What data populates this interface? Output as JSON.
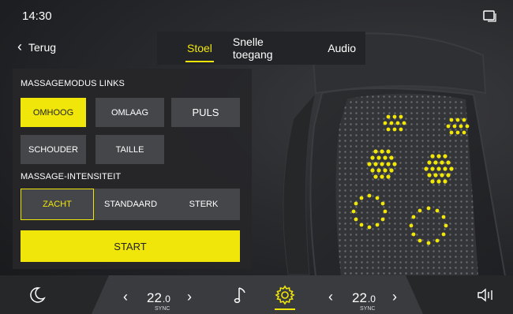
{
  "status": {
    "time": "14:30"
  },
  "nav": {
    "back_label": "Terug"
  },
  "tabs": [
    {
      "label": "Stoel",
      "active": true
    },
    {
      "label": "Snelle toegang",
      "active": false
    },
    {
      "label": "Audio",
      "active": false
    }
  ],
  "massage_mode": {
    "title": "MASSAGEMODUS LINKS",
    "options": [
      "OMHOOG",
      "OMLAAG",
      "PULS",
      "SCHOUDER",
      "TAILLE"
    ],
    "selected": "OMHOOG"
  },
  "intensity": {
    "title": "MASSAGE-INTENSITEIT",
    "options": [
      "ZACHT",
      "STANDAARD",
      "STERK"
    ],
    "selected": "ZACHT"
  },
  "start_label": "START",
  "climate": {
    "left": {
      "temp": "22",
      "decimal": ".0",
      "sync": "SYNC"
    },
    "right": {
      "temp": "22",
      "decimal": ".0",
      "sync": "SYNC"
    }
  },
  "colors": {
    "accent": "#f0e60a",
    "panel": "#26272a",
    "button": "#45464a"
  },
  "icons": [
    "phone-mirror-icon",
    "back-chevron-icon",
    "moon-icon",
    "music-note-icon",
    "seat-settings-icon",
    "volume-icon"
  ]
}
